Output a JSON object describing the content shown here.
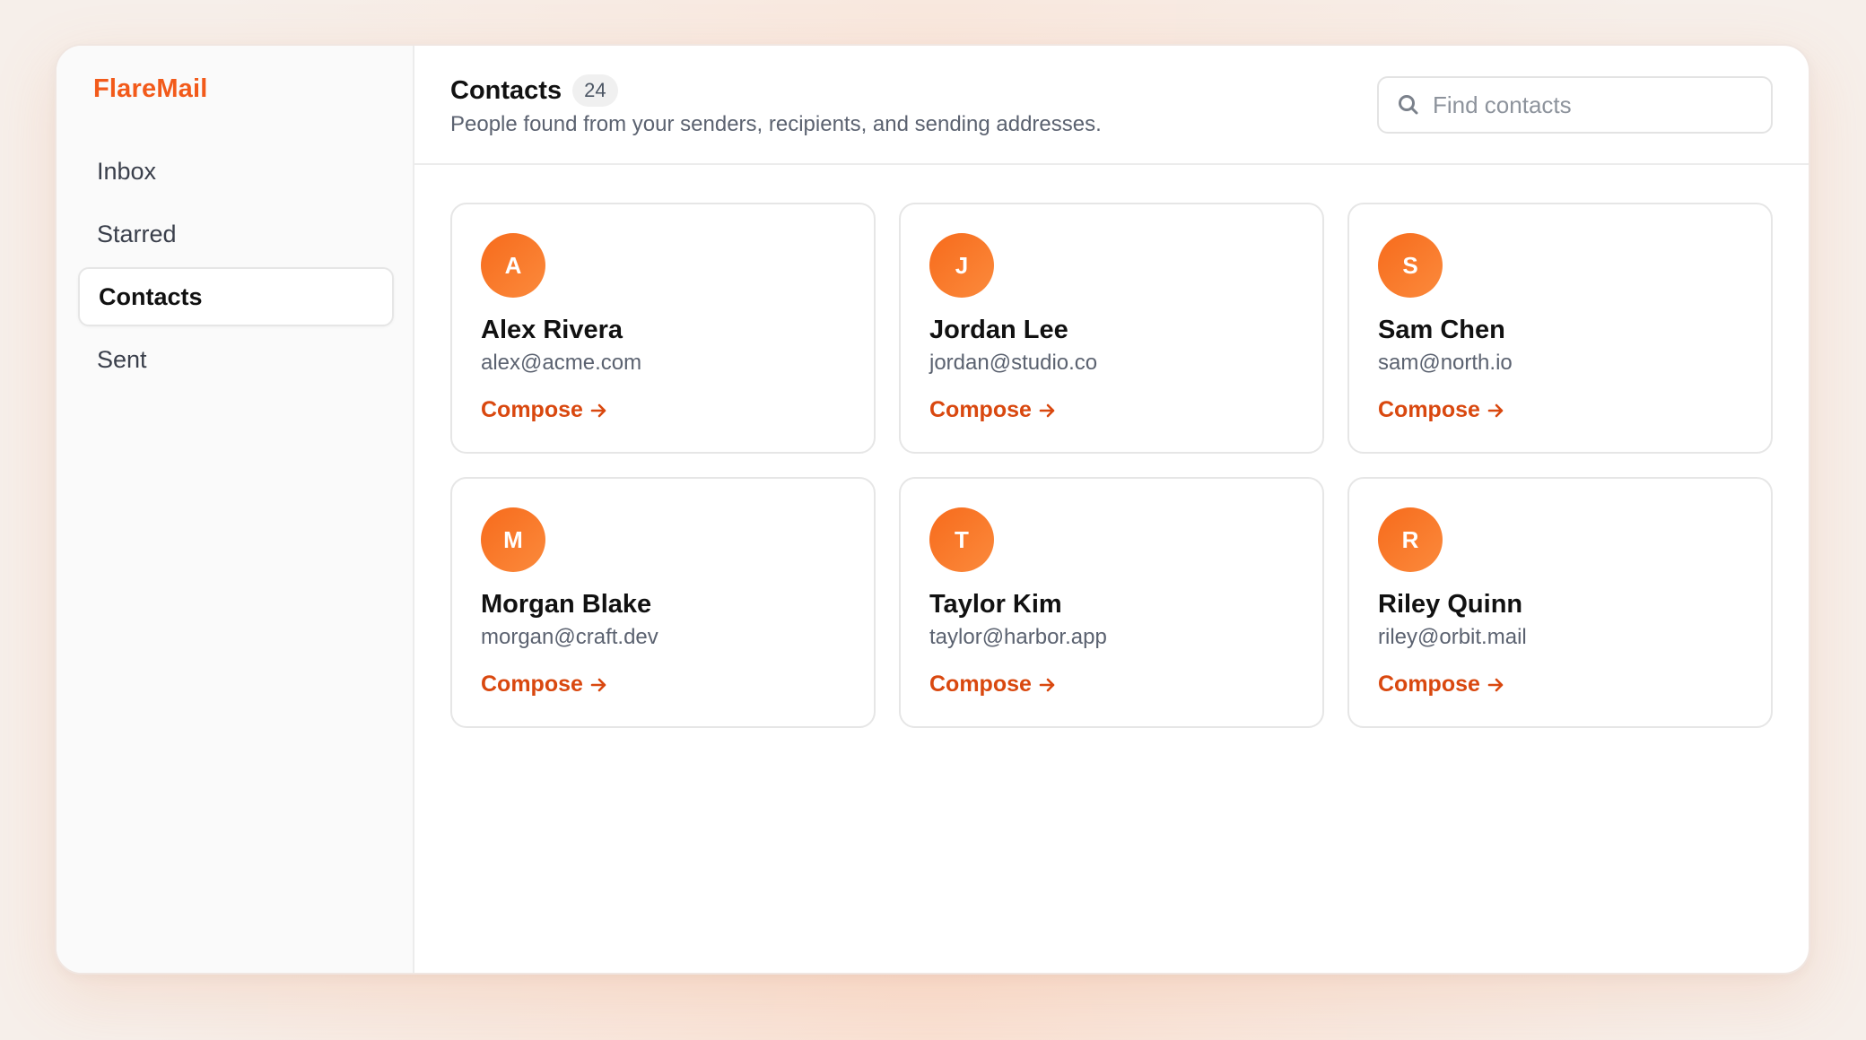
{
  "brand": {
    "name": "FlareMail"
  },
  "sidebar": {
    "items": [
      {
        "label": "Inbox",
        "active": false
      },
      {
        "label": "Starred",
        "active": false
      },
      {
        "label": "Contacts",
        "active": true
      },
      {
        "label": "Sent",
        "active": false
      }
    ]
  },
  "header": {
    "title": "Contacts",
    "count": "24",
    "subtitle": "People found from your senders, recipients, and sending addresses."
  },
  "search": {
    "placeholder": "Find contacts",
    "value": "",
    "icon": "search-icon"
  },
  "contacts": [
    {
      "initial": "A",
      "name": "Alex Rivera",
      "email": "alex@acme.com",
      "action": "Compose"
    },
    {
      "initial": "J",
      "name": "Jordan Lee",
      "email": "jordan@studio.co",
      "action": "Compose"
    },
    {
      "initial": "S",
      "name": "Sam Chen",
      "email": "sam@north.io",
      "action": "Compose"
    },
    {
      "initial": "M",
      "name": "Morgan Blake",
      "email": "morgan@craft.dev",
      "action": "Compose"
    },
    {
      "initial": "T",
      "name": "Taylor Kim",
      "email": "taylor@harbor.app",
      "action": "Compose"
    },
    {
      "initial": "R",
      "name": "Riley Quinn",
      "email": "riley@orbit.mail",
      "action": "Compose"
    }
  ],
  "colors": {
    "accent": "#f25a1a",
    "link": "#d9480f",
    "avatar_start": "#f76b1c",
    "avatar_end": "#fb8a3c"
  }
}
